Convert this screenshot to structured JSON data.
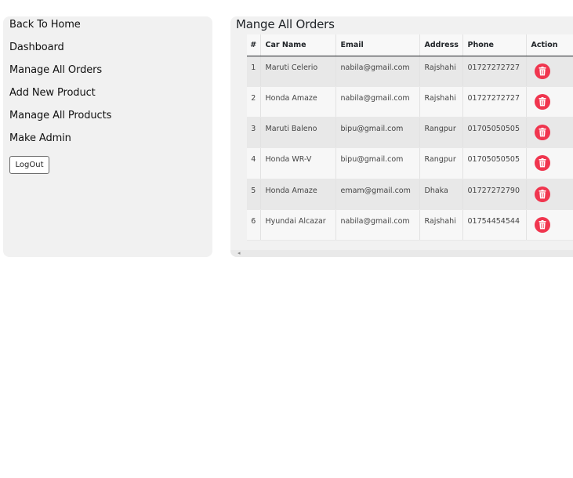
{
  "sidebar": {
    "items": [
      {
        "label": "Back To Home"
      },
      {
        "label": "Dashboard"
      },
      {
        "label": "Manage All Orders"
      },
      {
        "label": "Add New Product"
      },
      {
        "label": "Manage All Products"
      },
      {
        "label": "Make Admin"
      }
    ],
    "logout_label": "LogOut"
  },
  "main": {
    "title": "Mange All Orders",
    "table": {
      "headers": [
        "#",
        "Car Name",
        "Email",
        "Address",
        "Phone",
        "Action"
      ],
      "rows": [
        {
          "num": "1",
          "car": "Maruti Celerio",
          "email": "nabila@gmail.com",
          "address": "Rajshahi",
          "phone": "01727272727",
          "action_icon": "trash-icon"
        },
        {
          "num": "2",
          "car": "Honda Amaze",
          "email": "nabila@gmail.com",
          "address": "Rajshahi",
          "phone": "01727272727",
          "action_icon": "trash-icon"
        },
        {
          "num": "3",
          "car": "Maruti Baleno",
          "email": "bipu@gmail.com",
          "address": "Rangpur",
          "phone": "01705050505",
          "action_icon": "trash-icon"
        },
        {
          "num": "4",
          "car": "Honda WR-V",
          "email": "bipu@gmail.com",
          "address": "Rangpur",
          "phone": "01705050505",
          "action_icon": "trash-icon"
        },
        {
          "num": "5",
          "car": "Honda Amaze",
          "email": "emam@gmail.com",
          "address": "Dhaka",
          "phone": "01727272790",
          "action_icon": "trash-icon"
        },
        {
          "num": "6",
          "car": "Hyundai Alcazar",
          "email": "nabila@gmail.com",
          "address": "Rajshahi",
          "phone": "01754454544",
          "action_icon": "trash-icon"
        }
      ]
    }
  },
  "colors": {
    "delete_button": "#f0364f",
    "panel_bg": "#f1f1f1"
  }
}
